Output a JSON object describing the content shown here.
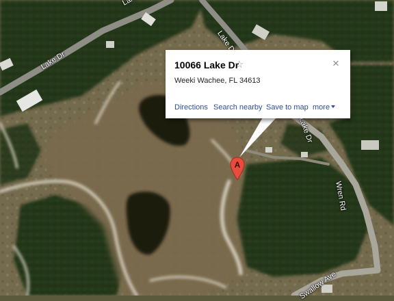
{
  "map": {
    "view": "satellite",
    "colors": {
      "grass": "#72694c",
      "tree": "#1f2f15",
      "pond": "#1e1a10",
      "road": "#8e8e86",
      "sand": "#d8d3c3"
    }
  },
  "road_labels": {
    "lake_dr_top": "Lake Dr",
    "lake_dr_left": "Lake Dr",
    "lake_dr_center": "Lake Dr",
    "lake_dr_right": "Lake Dr",
    "wren_rd": "Wren Rd",
    "swallow_ave": "Swallow Ave"
  },
  "marker": {
    "label": "A",
    "color": "#e74c3c"
  },
  "infowindow": {
    "title": "10066 Lake Dr",
    "star_icon": "☆",
    "close_icon": "×",
    "address": "Weeki Wachee, FL 34613",
    "actions": {
      "directions": "Directions",
      "search_nearby": "Search nearby",
      "save_to_map": "Save to map",
      "more": "more"
    }
  }
}
